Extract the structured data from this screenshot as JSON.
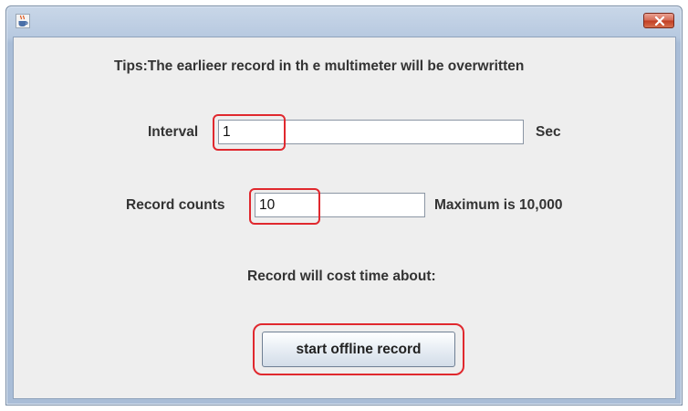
{
  "window": {
    "title": "",
    "close_symbol": "×",
    "app_icon": "java-coffee-cup-icon"
  },
  "tips": "Tips:The earlieer record in th e multimeter will be overwritten",
  "interval": {
    "label": "Interval",
    "value": "1",
    "unit": "Sec"
  },
  "record_counts": {
    "label": "Record counts",
    "value": "10",
    "note": "Maximum is 10,000"
  },
  "duration_text": "Record will cost time about:",
  "start_button_label": "start offline record",
  "colors": {
    "highlight": "#e0282e",
    "close_button": "#c13d23",
    "window_frame": "#b7c9e0"
  }
}
